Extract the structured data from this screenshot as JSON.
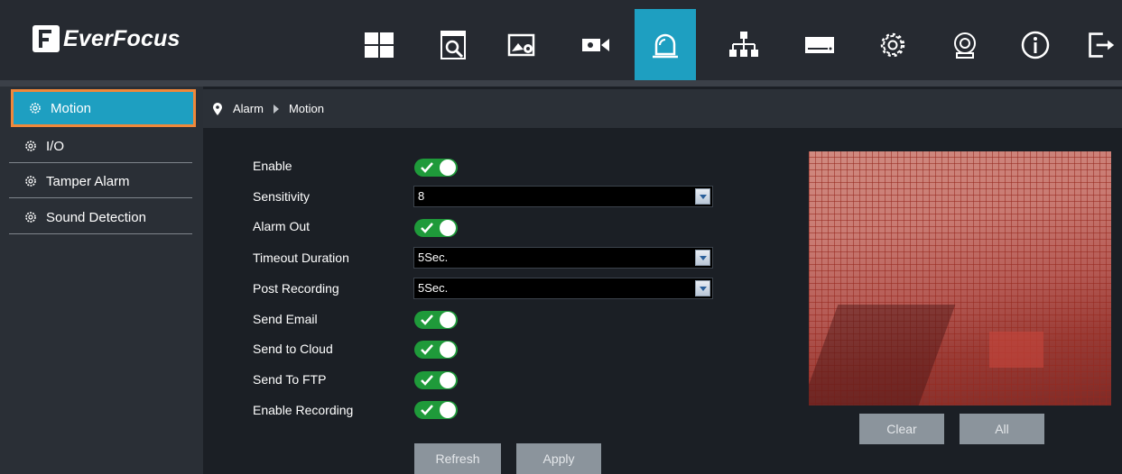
{
  "brand": {
    "name": "EverFocus"
  },
  "topnav": {
    "icons": [
      "live-view-icon",
      "playback-search-icon",
      "image-settings-icon",
      "record-icon",
      "alarm-icon",
      "network-icon",
      "storage-icon",
      "system-settings-icon",
      "maintenance-icon",
      "info-icon",
      "logout-icon"
    ],
    "active": "alarm-icon",
    "accent": "#1e9fc1"
  },
  "sidebar": {
    "items": [
      {
        "label": "Motion",
        "active": true
      },
      {
        "label": "I/O"
      },
      {
        "label": "Tamper Alarm"
      },
      {
        "label": "Sound Detection"
      }
    ]
  },
  "breadcrumb": {
    "section": "Alarm",
    "page": "Motion"
  },
  "form": {
    "enable": {
      "label": "Enable",
      "on": true
    },
    "sensitivity": {
      "label": "Sensitivity",
      "value": "8"
    },
    "alarm_out": {
      "label": "Alarm Out",
      "on": true
    },
    "timeout_duration": {
      "label": "Timeout Duration",
      "value": "5Sec."
    },
    "post_recording": {
      "label": "Post Recording",
      "value": "5Sec."
    },
    "send_email": {
      "label": "Send Email",
      "on": true
    },
    "send_to_cloud": {
      "label": "Send to Cloud",
      "on": true
    },
    "send_to_ftp": {
      "label": "Send To FTP",
      "on": true
    },
    "enable_recording": {
      "label": "Enable Recording",
      "on": true
    }
  },
  "buttons": {
    "refresh": "Refresh",
    "apply": "Apply",
    "clear": "Clear",
    "all": "All"
  },
  "colors": {
    "toggle_on": "#1f9a3a",
    "highlight_border": "#f0883a",
    "button": "#8b949c"
  }
}
